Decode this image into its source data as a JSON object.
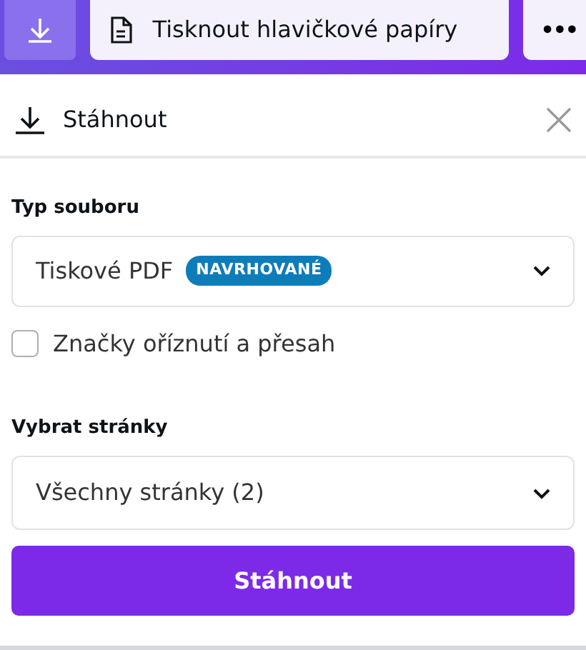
{
  "toolbar": {
    "document_title": "Tisknout hlavičkové papíry",
    "more_label": "•••"
  },
  "panel": {
    "title": "Stáhnout"
  },
  "file_type": {
    "label": "Typ souboru",
    "value": "Tiskové PDF",
    "badge": "NAVRHOVANÉ"
  },
  "crop_marks": {
    "label": "Značky oříznutí a přesah",
    "checked": false
  },
  "pages": {
    "label": "Vybrat stránky",
    "value": "Všechny stránky (2)"
  },
  "download_button": "Stáhnout"
}
